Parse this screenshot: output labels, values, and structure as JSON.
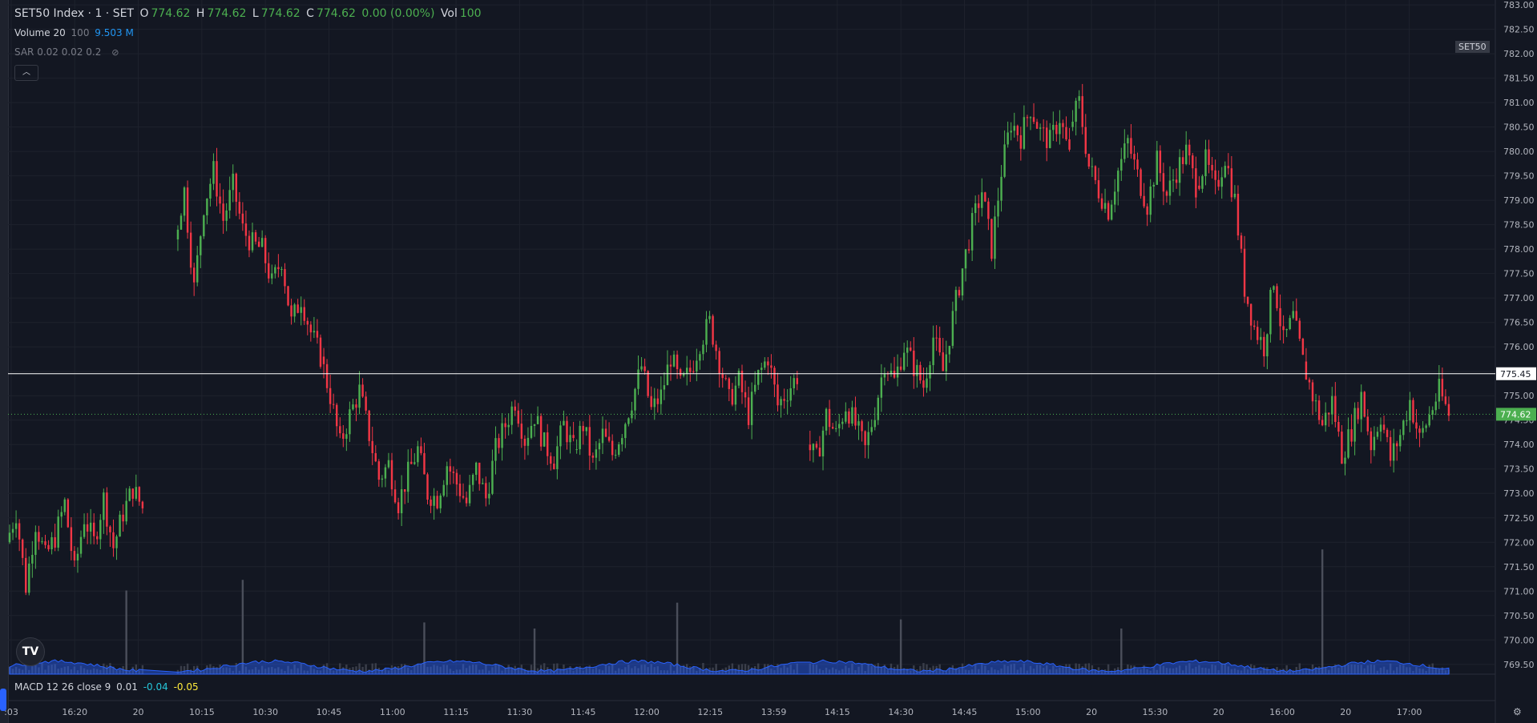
{
  "legend": {
    "symbol": "SET50 Index · 1 · SET",
    "o_label": "O",
    "o": "774.62",
    "h_label": "H",
    "h": "774.62",
    "l_label": "L",
    "l": "774.62",
    "c_label": "C",
    "c": "774.62",
    "change": "0.00 (0.00%)",
    "vol_label": "Vol",
    "vol": "100"
  },
  "volume_indicator": {
    "label": "Volume 20",
    "p1": "100",
    "p2": "9.503 M"
  },
  "sar_indicator": {
    "label": "SAR 0.02 0.02 0.2"
  },
  "macd_indicator": {
    "label": "MACD 12 26 close 9",
    "v1": "0.01",
    "v2": "-0.04",
    "v3": "-0.05"
  },
  "symbol_tag": "SET50",
  "logo_text": "TV",
  "colors": {
    "bg": "#131722",
    "up": "#4caf50",
    "down": "#f23645",
    "grid": "#1e222d",
    "vol_ma": "#2962ff",
    "axis_text": "#b2b5be"
  },
  "icons": {
    "collapse": "chevron-up-icon",
    "hide": "eye-slash-icon",
    "settings": "gear-icon"
  },
  "chart_data": {
    "type": "candlestick",
    "title": "SET50 Index · 1 · SET",
    "y_ticks": [
      "769.50",
      "770.00",
      "770.50",
      "771.00",
      "771.50",
      "772.00",
      "772.50",
      "773.00",
      "773.50",
      "774.00",
      "774.50",
      "775.00",
      "775.50",
      "776.00",
      "776.50",
      "777.00",
      "777.50",
      "778.00",
      "778.50",
      "779.00",
      "779.50",
      "780.00",
      "780.50",
      "781.00",
      "781.50",
      "782.00",
      "782.50",
      "783.00"
    ],
    "ylim": [
      769.3,
      783.1
    ],
    "x_ticks": [
      ":03",
      "16:20",
      "20",
      "10:15",
      "10:30",
      "10:45",
      "11:00",
      "11:15",
      "11:30",
      "11:45",
      "12:00",
      "12:15",
      "13:59",
      "14:15",
      "14:30",
      "14:45",
      "15:00",
      "20",
      "15:30",
      "20",
      "16:00",
      "20",
      "17:00"
    ],
    "horizontal_line": {
      "value": 775.45,
      "label": "775.45"
    },
    "last_price": {
      "value": 774.62,
      "label": "774.62"
    },
    "segments": [
      {
        "from": "15:56",
        "to": "16:29",
        "open": 772.0,
        "points": [
          772.6,
          771.1,
          772.4,
          771.7,
          772.1,
          772.8,
          771.4,
          772.5,
          772.0,
          772.9,
          771.9,
          772.6,
          773.1,
          772.7
        ]
      },
      {
        "from": "10:00",
        "to": "10:30",
        "open": 778.2,
        "points": [
          779.2,
          777.2,
          778.9,
          779.6,
          778.6,
          779.3,
          778.4,
          778.1,
          778.0,
          777.3,
          777.8,
          776.5,
          777.0,
          776.3,
          775.8
        ]
      },
      {
        "from": "10:30",
        "to": "11:00",
        "open": 775.8,
        "points": [
          775.0,
          774.0,
          774.6,
          775.1,
          774.2,
          773.3,
          773.6,
          772.8,
          773.4,
          773.9,
          773.0,
          772.9,
          773.6,
          773.2
        ]
      },
      {
        "from": "11:00",
        "to": "11:30",
        "open": 773.2,
        "points": [
          772.8,
          773.5,
          772.9,
          773.9,
          774.4,
          774.9,
          774.1,
          774.6,
          774.0,
          773.7,
          774.4,
          773.9
        ]
      },
      {
        "from": "11:30",
        "to": "12:00",
        "open": 773.9,
        "points": [
          774.4,
          773.6,
          774.2,
          773.8,
          774.3,
          774.9,
          775.6,
          774.7,
          775.0,
          775.8,
          775.2,
          775.5
        ]
      },
      {
        "from": "12:00",
        "to": "12:30",
        "open": 775.5,
        "points": [
          776.1,
          776.5,
          775.7,
          774.9,
          775.3,
          774.6,
          775.4,
          775.8,
          774.8,
          775.1,
          775.4
        ]
      },
      {
        "from": "13:59",
        "to": "14:30",
        "open": 774.0,
        "points": [
          773.7,
          774.6,
          774.2,
          774.8,
          774.4,
          773.9,
          774.7,
          775.7,
          775.3,
          776.0,
          775.6,
          775.2,
          776.2,
          775.5
        ]
      },
      {
        "from": "14:30",
        "to": "15:00",
        "open": 775.5,
        "points": [
          776.6,
          777.6,
          778.5,
          779.2,
          778.0,
          779.6,
          780.6,
          780.3,
          780.9,
          780.4,
          780.2,
          780.7,
          779.9
        ]
      },
      {
        "from": "15:00",
        "to": "15:30",
        "open": 780.5,
        "points": [
          781.0,
          779.7,
          779.2,
          778.8,
          779.6,
          780.2,
          779.5,
          778.9,
          779.8,
          779.1,
          779.6,
          780.0,
          779.3
        ]
      },
      {
        "from": "15:30",
        "to": "16:00",
        "open": 779.3,
        "points": [
          779.8,
          779.2,
          779.9,
          779.0,
          777.2,
          776.4,
          776.0,
          777.4,
          776.1,
          776.6,
          775.7
        ]
      },
      {
        "from": "16:00",
        "to": "16:40",
        "open": 775.7,
        "points": [
          775.0,
          774.4,
          774.9,
          773.8,
          774.3,
          775.0,
          774.0,
          774.6,
          773.7,
          774.2,
          774.9,
          774.1,
          774.6,
          775.1,
          774.62
        ]
      }
    ],
    "volume": {
      "unit": "shares",
      "ma_length": 20,
      "bars_shown": true,
      "notable_spikes_relative": [
        0.55,
        0.62,
        0.34,
        0.3,
        0.47,
        0.36,
        0.3,
        0.82
      ]
    },
    "macd": {
      "fast": 12,
      "slow": 26,
      "signal": 9,
      "macd": 0.01,
      "signal_value": -0.04,
      "hist": -0.05
    },
    "grid": true
  }
}
